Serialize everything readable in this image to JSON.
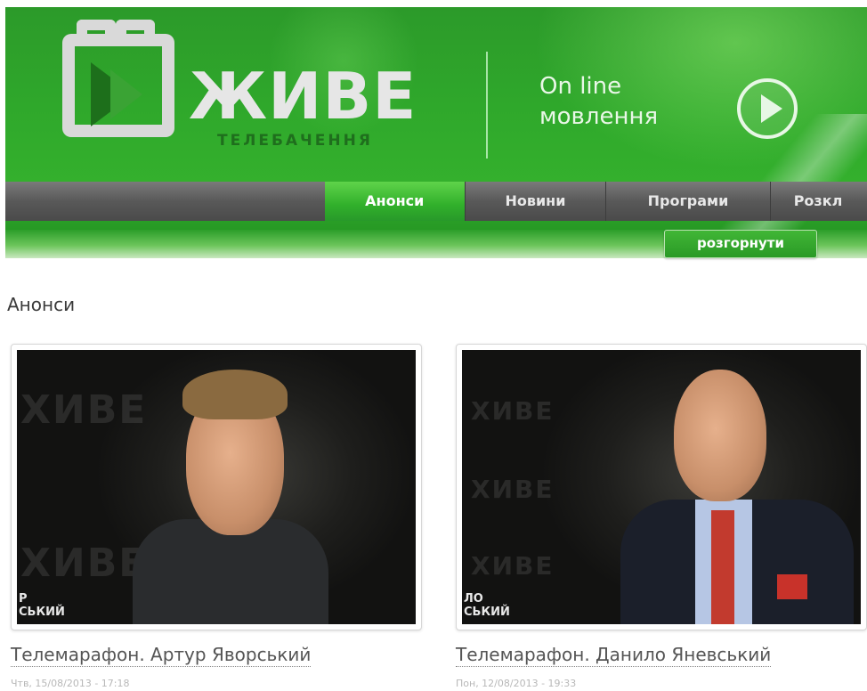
{
  "header": {
    "logo_word": "ЖИВЕ",
    "logo_sub": "ТЕЛЕБАЧЕННЯ",
    "online_line1": "On line",
    "online_line2": "мовлення"
  },
  "nav": {
    "items": [
      {
        "label": "Анонси",
        "active": true
      },
      {
        "label": "Новини",
        "active": false
      },
      {
        "label": "Програми",
        "active": false
      },
      {
        "label": "Розкл",
        "active": false
      }
    ],
    "expand_label": "розгорнути"
  },
  "main": {
    "section_title": "Анонси",
    "cards": [
      {
        "title": "Телемарафон. Артур Яворський",
        "date": "Чтв, 15/08/2013 - 17:18",
        "watermark": "ХИВЕ",
        "lower_third": "Р\nСЬКИЙ"
      },
      {
        "title": "Телемарафон. Данило Яневський",
        "date": "Пон, 12/08/2013 - 19:33",
        "watermark": "ХИВЕ",
        "lower_third": "ЛО\nСЬКИЙ"
      }
    ]
  },
  "colors": {
    "brand_green": "#2fa82b",
    "nav_gray": "#595959",
    "active_green": "#31b02b"
  },
  "icons": [
    "logo-tv-icon",
    "play-icon"
  ]
}
